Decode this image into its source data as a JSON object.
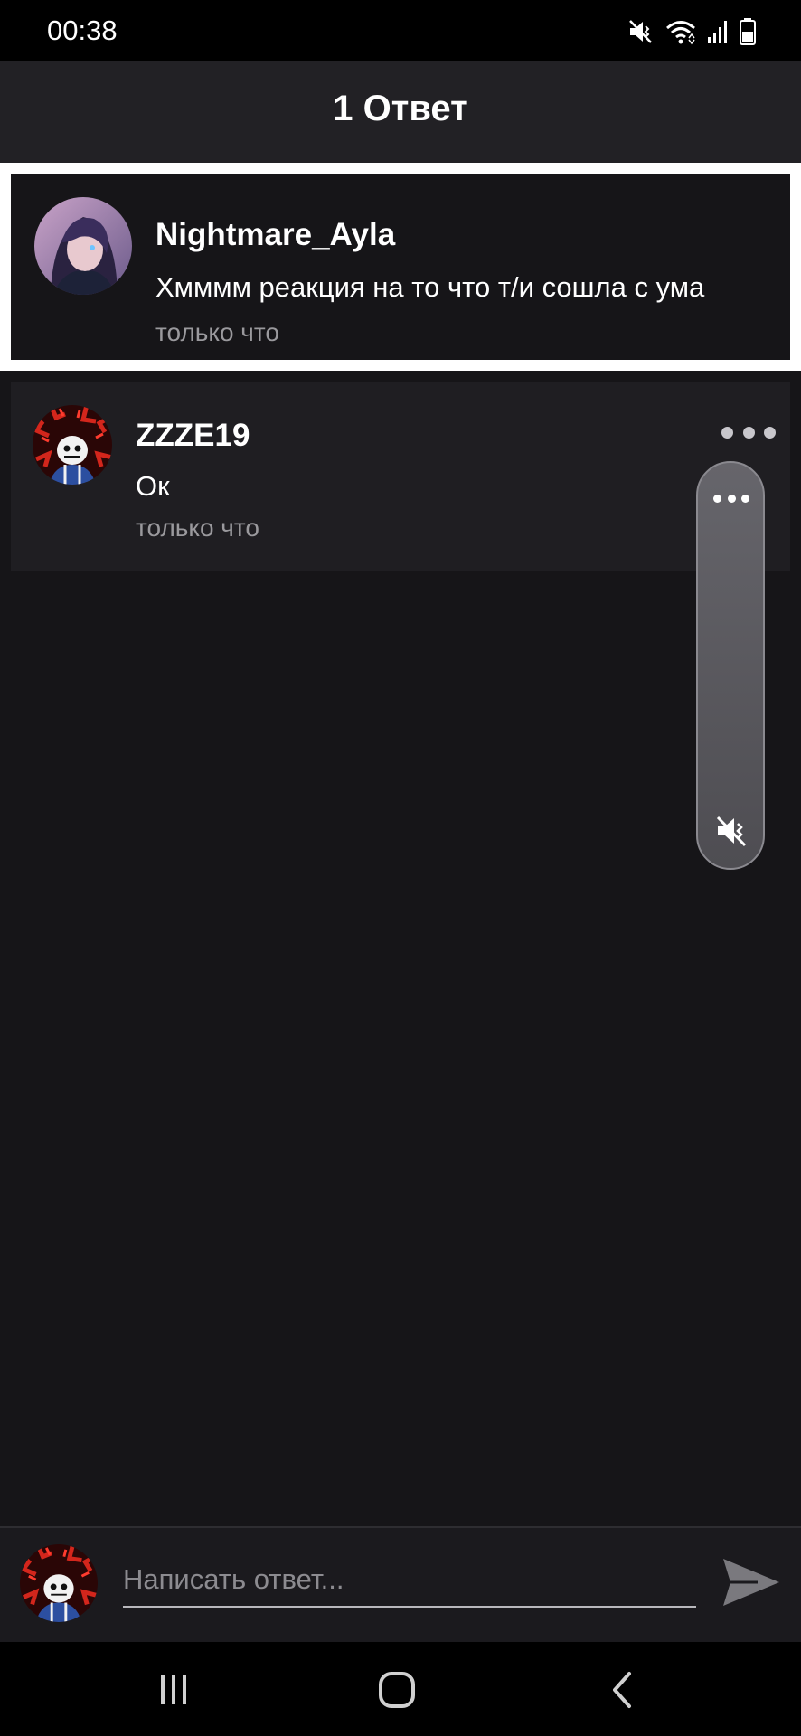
{
  "status_bar": {
    "time": "00:38",
    "icons": [
      "mute-icon",
      "wifi-icon",
      "signal-icon",
      "battery-icon"
    ]
  },
  "header": {
    "title": "1 Ответ"
  },
  "parent_comment": {
    "author": "Nightmare_Ayla",
    "text": "Хмммм реакция на то что т/и сошла с ума",
    "time": "только что"
  },
  "replies": [
    {
      "author": "ZZZE19",
      "text": "Ок",
      "time": "только что"
    }
  ],
  "reply_bar": {
    "placeholder": "Написать ответ..."
  },
  "nav_bar": {
    "buttons": [
      "recent-apps",
      "home",
      "back"
    ]
  },
  "colors": {
    "background": "#161518",
    "header": "#222125",
    "reply_card": "#1f1e22",
    "muted_text": "#9a999d",
    "highlight_border": "#ffffff"
  }
}
